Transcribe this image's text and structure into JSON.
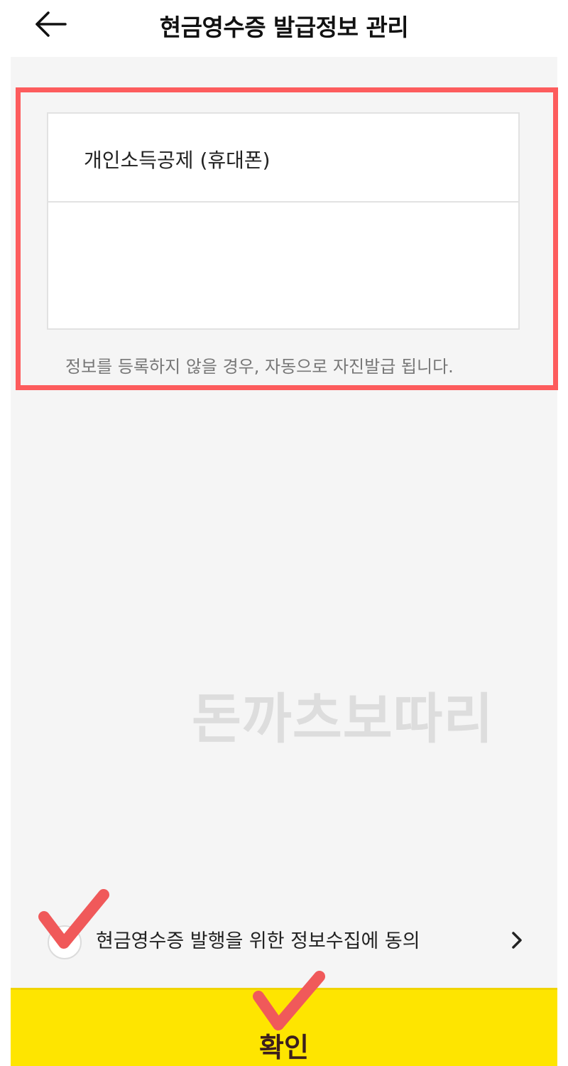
{
  "header": {
    "back_icon": "arrow-left-icon",
    "title": "현금영수증 발급정보 관리"
  },
  "receipt_info": {
    "option_label": "개인소득공제 (휴대폰)",
    "notice": "정보를 등록하지 않을 경우, 자동으로 자진발급 됩니다."
  },
  "watermark": "돈까츠보따리",
  "agreement": {
    "label": "현금영수증 발행을 위한 정보수집에 동의",
    "chevron_icon": "chevron-right-icon"
  },
  "confirm": {
    "label": "확인"
  },
  "colors": {
    "highlight": "#fd5c5d",
    "confirm_bg": "#fee500",
    "confirm_text": "#3b1e1e",
    "background": "#f5f5f5"
  }
}
